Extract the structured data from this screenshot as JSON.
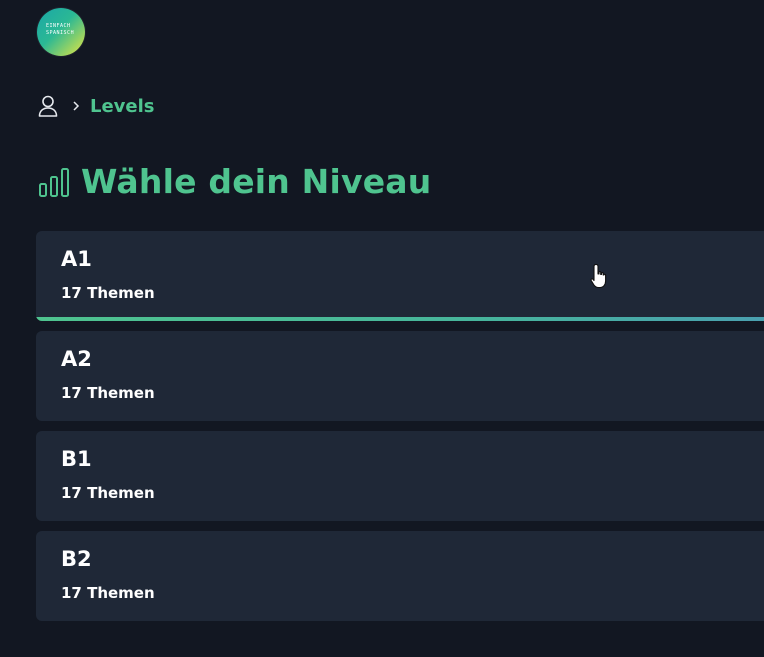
{
  "logo": {
    "text": "EINFACH\nSPANISCH"
  },
  "breadcrumb": {
    "current": "Levels"
  },
  "page": {
    "title": "Wähle dein Niveau"
  },
  "levels": [
    {
      "code": "A1",
      "count": "17 Themen"
    },
    {
      "code": "A2",
      "count": "17 Themen"
    },
    {
      "code": "B1",
      "count": "17 Themen"
    },
    {
      "code": "B2",
      "count": "17 Themen"
    }
  ],
  "colors": {
    "background": "#121722",
    "card": "#1f2837",
    "accent": "#4fc48f"
  },
  "icons": {
    "breadcrumb_home": "user-icon",
    "breadcrumb_separator": "chevron-right-icon",
    "title": "bar-chart-icon"
  }
}
